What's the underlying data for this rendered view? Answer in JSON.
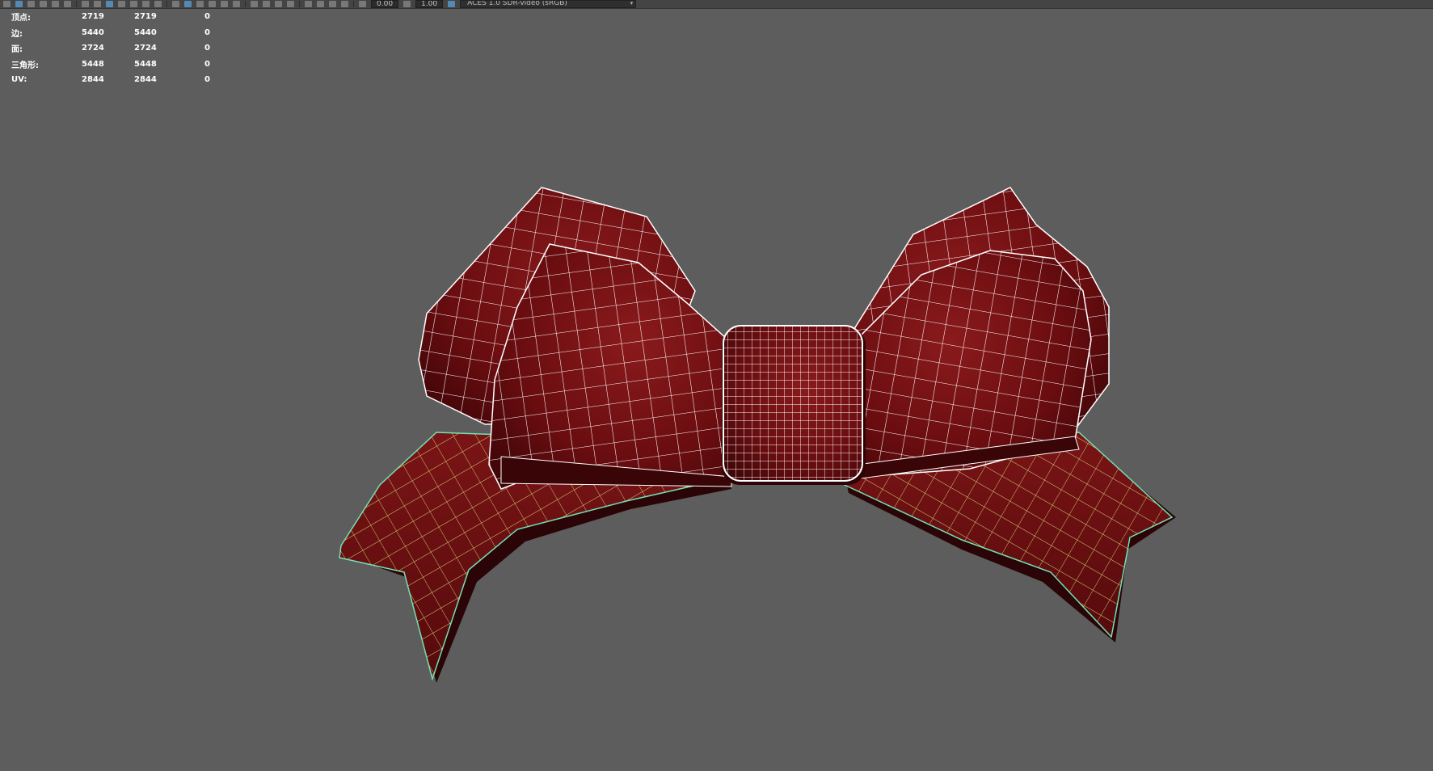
{
  "toolbar": {
    "exposure_value": "0.00",
    "gamma_value": "1.00",
    "color_space": "ACES 1.0 SDR-video (sRGB)"
  },
  "hud": {
    "rows": [
      {
        "label": "顶点:",
        "v1": "2719",
        "v2": "2719",
        "v3": "0"
      },
      {
        "label": "边:",
        "v1": "5440",
        "v2": "5440",
        "v3": "0"
      },
      {
        "label": "面:",
        "v1": "2724",
        "v2": "2724",
        "v3": "0"
      },
      {
        "label": "三角形:",
        "v1": "5448",
        "v2": "5448",
        "v3": "0"
      },
      {
        "label": "UV:",
        "v1": "2844",
        "v2": "2844",
        "v3": "0"
      }
    ]
  },
  "colors": {
    "viewport_bg": "#5d5d5d",
    "ribbon_red": "#6e0e12",
    "wire_white": "#ffffff",
    "wire_yellow": "#d8d67a",
    "selection_edge": "#6fe3b4"
  }
}
